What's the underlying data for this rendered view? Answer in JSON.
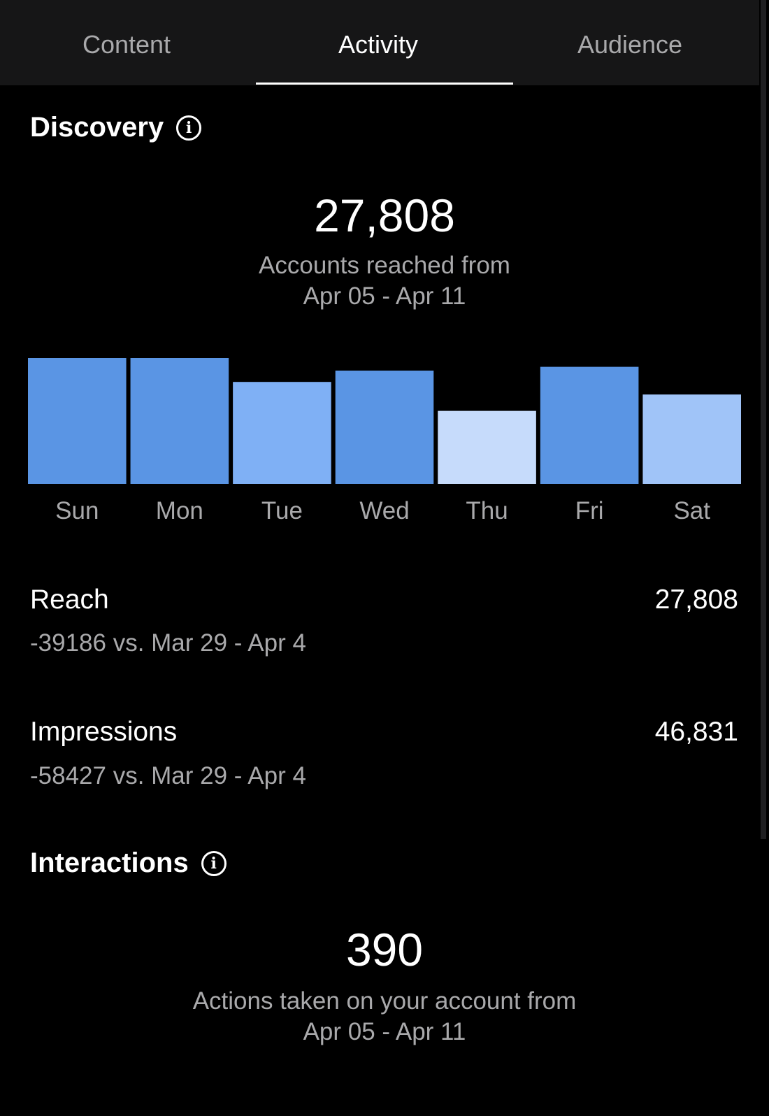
{
  "tabs": [
    {
      "label": "Content"
    },
    {
      "label": "Activity"
    },
    {
      "label": "Audience"
    }
  ],
  "active_tab": "Activity",
  "discovery": {
    "title": "Discovery",
    "total": "27,808",
    "caption_line1": "Accounts reached from",
    "caption_line2": "Apr 05 - Apr 11"
  },
  "chart_data": {
    "type": "bar",
    "categories": [
      "Sun",
      "Mon",
      "Tue",
      "Wed",
      "Thu",
      "Fri",
      "Sat"
    ],
    "values": [
      100,
      100,
      81,
      90,
      58,
      93,
      71
    ],
    "bar_colors": [
      "#5a95e4",
      "#5a95e4",
      "#7fb0f5",
      "#5a95e4",
      "#c6dbfb",
      "#5a95e4",
      "#a0c4f8"
    ],
    "ylim": [
      0,
      100
    ],
    "grid": false
  },
  "metrics": [
    {
      "label": "Reach",
      "value": "27,808",
      "comparison": "-39186 vs. Mar 29 - Apr 4"
    },
    {
      "label": "Impressions",
      "value": "46,831",
      "comparison": "-58427 vs. Mar 29 - Apr 4"
    }
  ],
  "interactions": {
    "title": "Interactions",
    "total": "390",
    "caption_line1": "Actions taken on your account from",
    "caption_line2": "Apr 05 - Apr 11"
  },
  "icons": {
    "info": "info-icon"
  },
  "colors": {
    "background": "#000000",
    "tabbar": "#161617",
    "muted_text": "#a9a9ab"
  }
}
